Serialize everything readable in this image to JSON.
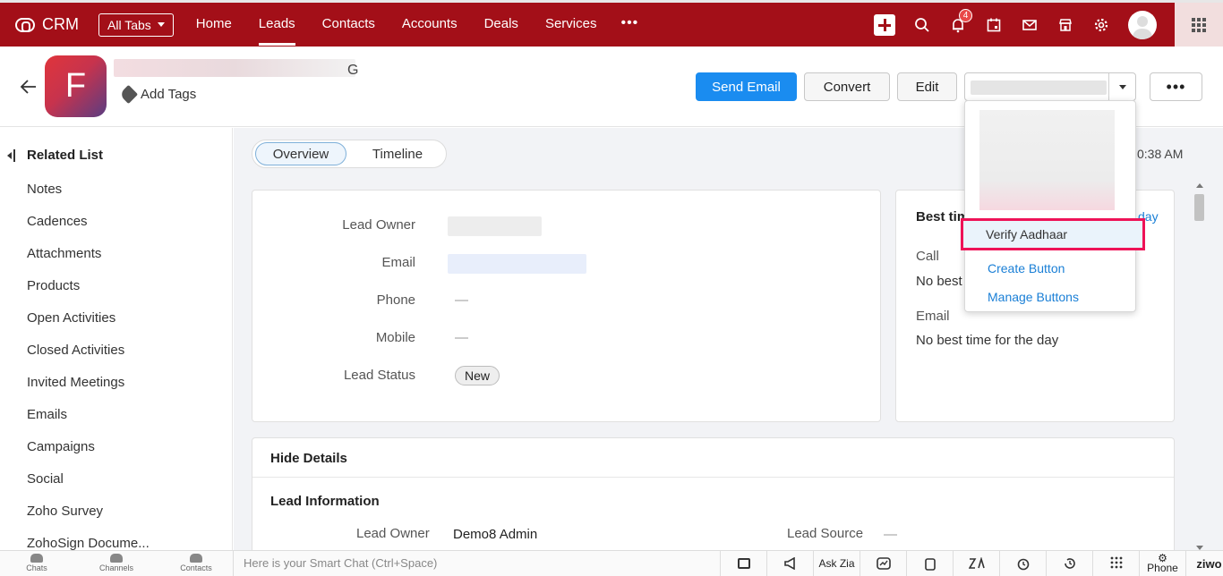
{
  "topnav": {
    "logo": "CRM",
    "all_tabs": "All Tabs",
    "tabs": [
      "Home",
      "Leads",
      "Contacts",
      "Accounts",
      "Deals",
      "Services"
    ],
    "more": "•••",
    "notification_count": "4",
    "accent": "#a30f18"
  },
  "record": {
    "avatar_letter": "F",
    "name_tail": "G",
    "add_tags": "Add Tags",
    "send_email": "Send Email",
    "convert": "Convert",
    "edit": "Edit",
    "more": "•••"
  },
  "dropdown": {
    "items": [
      "Verify Aadhaar",
      "Create Button",
      "Manage Buttons"
    ]
  },
  "sidebar": {
    "title": "Related List",
    "items": [
      "Notes",
      "Cadences",
      "Attachments",
      "Products",
      "Open Activities",
      "Closed Activities",
      "Invited Meetings",
      "Emails",
      "Campaigns",
      "Social",
      "Zoho Survey",
      "ZohoSign Docume..."
    ]
  },
  "main": {
    "tabs": [
      "Overview",
      "Timeline"
    ],
    "timestamp": "0:38 AM",
    "overview": {
      "labels": [
        "Lead Owner",
        "Email",
        "Phone",
        "Mobile",
        "Lead Status"
      ],
      "phone": "—",
      "mobile": "—",
      "status": "New"
    },
    "best_time": {
      "title": "Best tim",
      "link": "day",
      "call_label": "Call",
      "call_value": "No best t",
      "email_label": "Email",
      "email_value": "No best time for the day"
    },
    "details": {
      "hide": "Hide Details",
      "section": "Lead Information",
      "lead_owner_label": "Lead Owner",
      "lead_owner_value": "Demo8 Admin",
      "lead_source_label": "Lead Source",
      "lead_source_value": "—"
    }
  },
  "bottombar": {
    "chats": "Chats",
    "channels": "Channels",
    "contacts": "Contacts",
    "smartchat": "Here is your Smart Chat (Ctrl+Space)",
    "ask_zia": "Ask Zia",
    "phone": "Phone",
    "ziwo": "ziwo"
  }
}
